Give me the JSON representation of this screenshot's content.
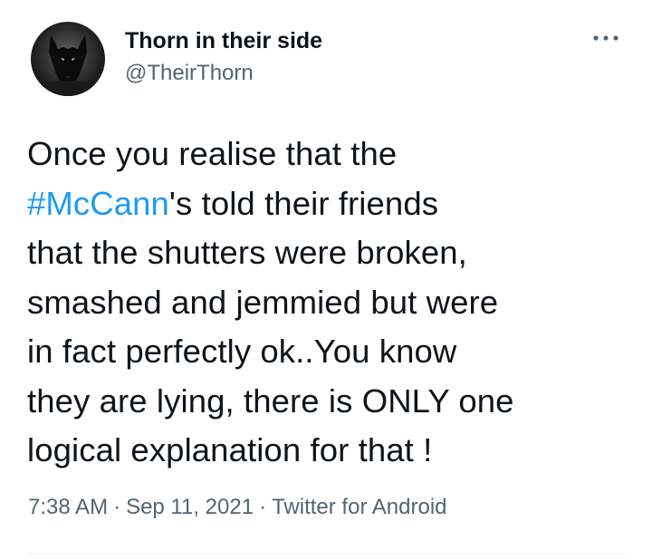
{
  "author": {
    "display_name": "Thorn in their side",
    "handle": "@TheirThorn",
    "avatar_icon": "wolf-avatar-icon"
  },
  "more_icon": "ellipsis-icon",
  "tweet": {
    "lines": [
      {
        "before": "Once you realise that the",
        "hashtag": "",
        "after": ""
      },
      {
        "before": "",
        "hashtag": "#McCann",
        "after": "'s told their friends"
      },
      {
        "before": "that the shutters were broken,",
        "hashtag": "",
        "after": ""
      },
      {
        "before": "smashed and jemmied but were",
        "hashtag": "",
        "after": ""
      },
      {
        "before": "in fact perfectly ok..You know",
        "hashtag": "",
        "after": ""
      },
      {
        "before": "they are lying, there is ONLY one",
        "hashtag": "",
        "after": ""
      },
      {
        "before": "logical explanation for that !",
        "hashtag": "",
        "after": ""
      }
    ]
  },
  "meta": {
    "time": "7:38 AM",
    "separator": "·",
    "date": "Sep 11, 2021",
    "source": "Twitter for Android"
  },
  "colors": {
    "text": "#0f1419",
    "secondary": "#536471",
    "link": "#1d9bf0",
    "divider": "#eff3f4"
  }
}
